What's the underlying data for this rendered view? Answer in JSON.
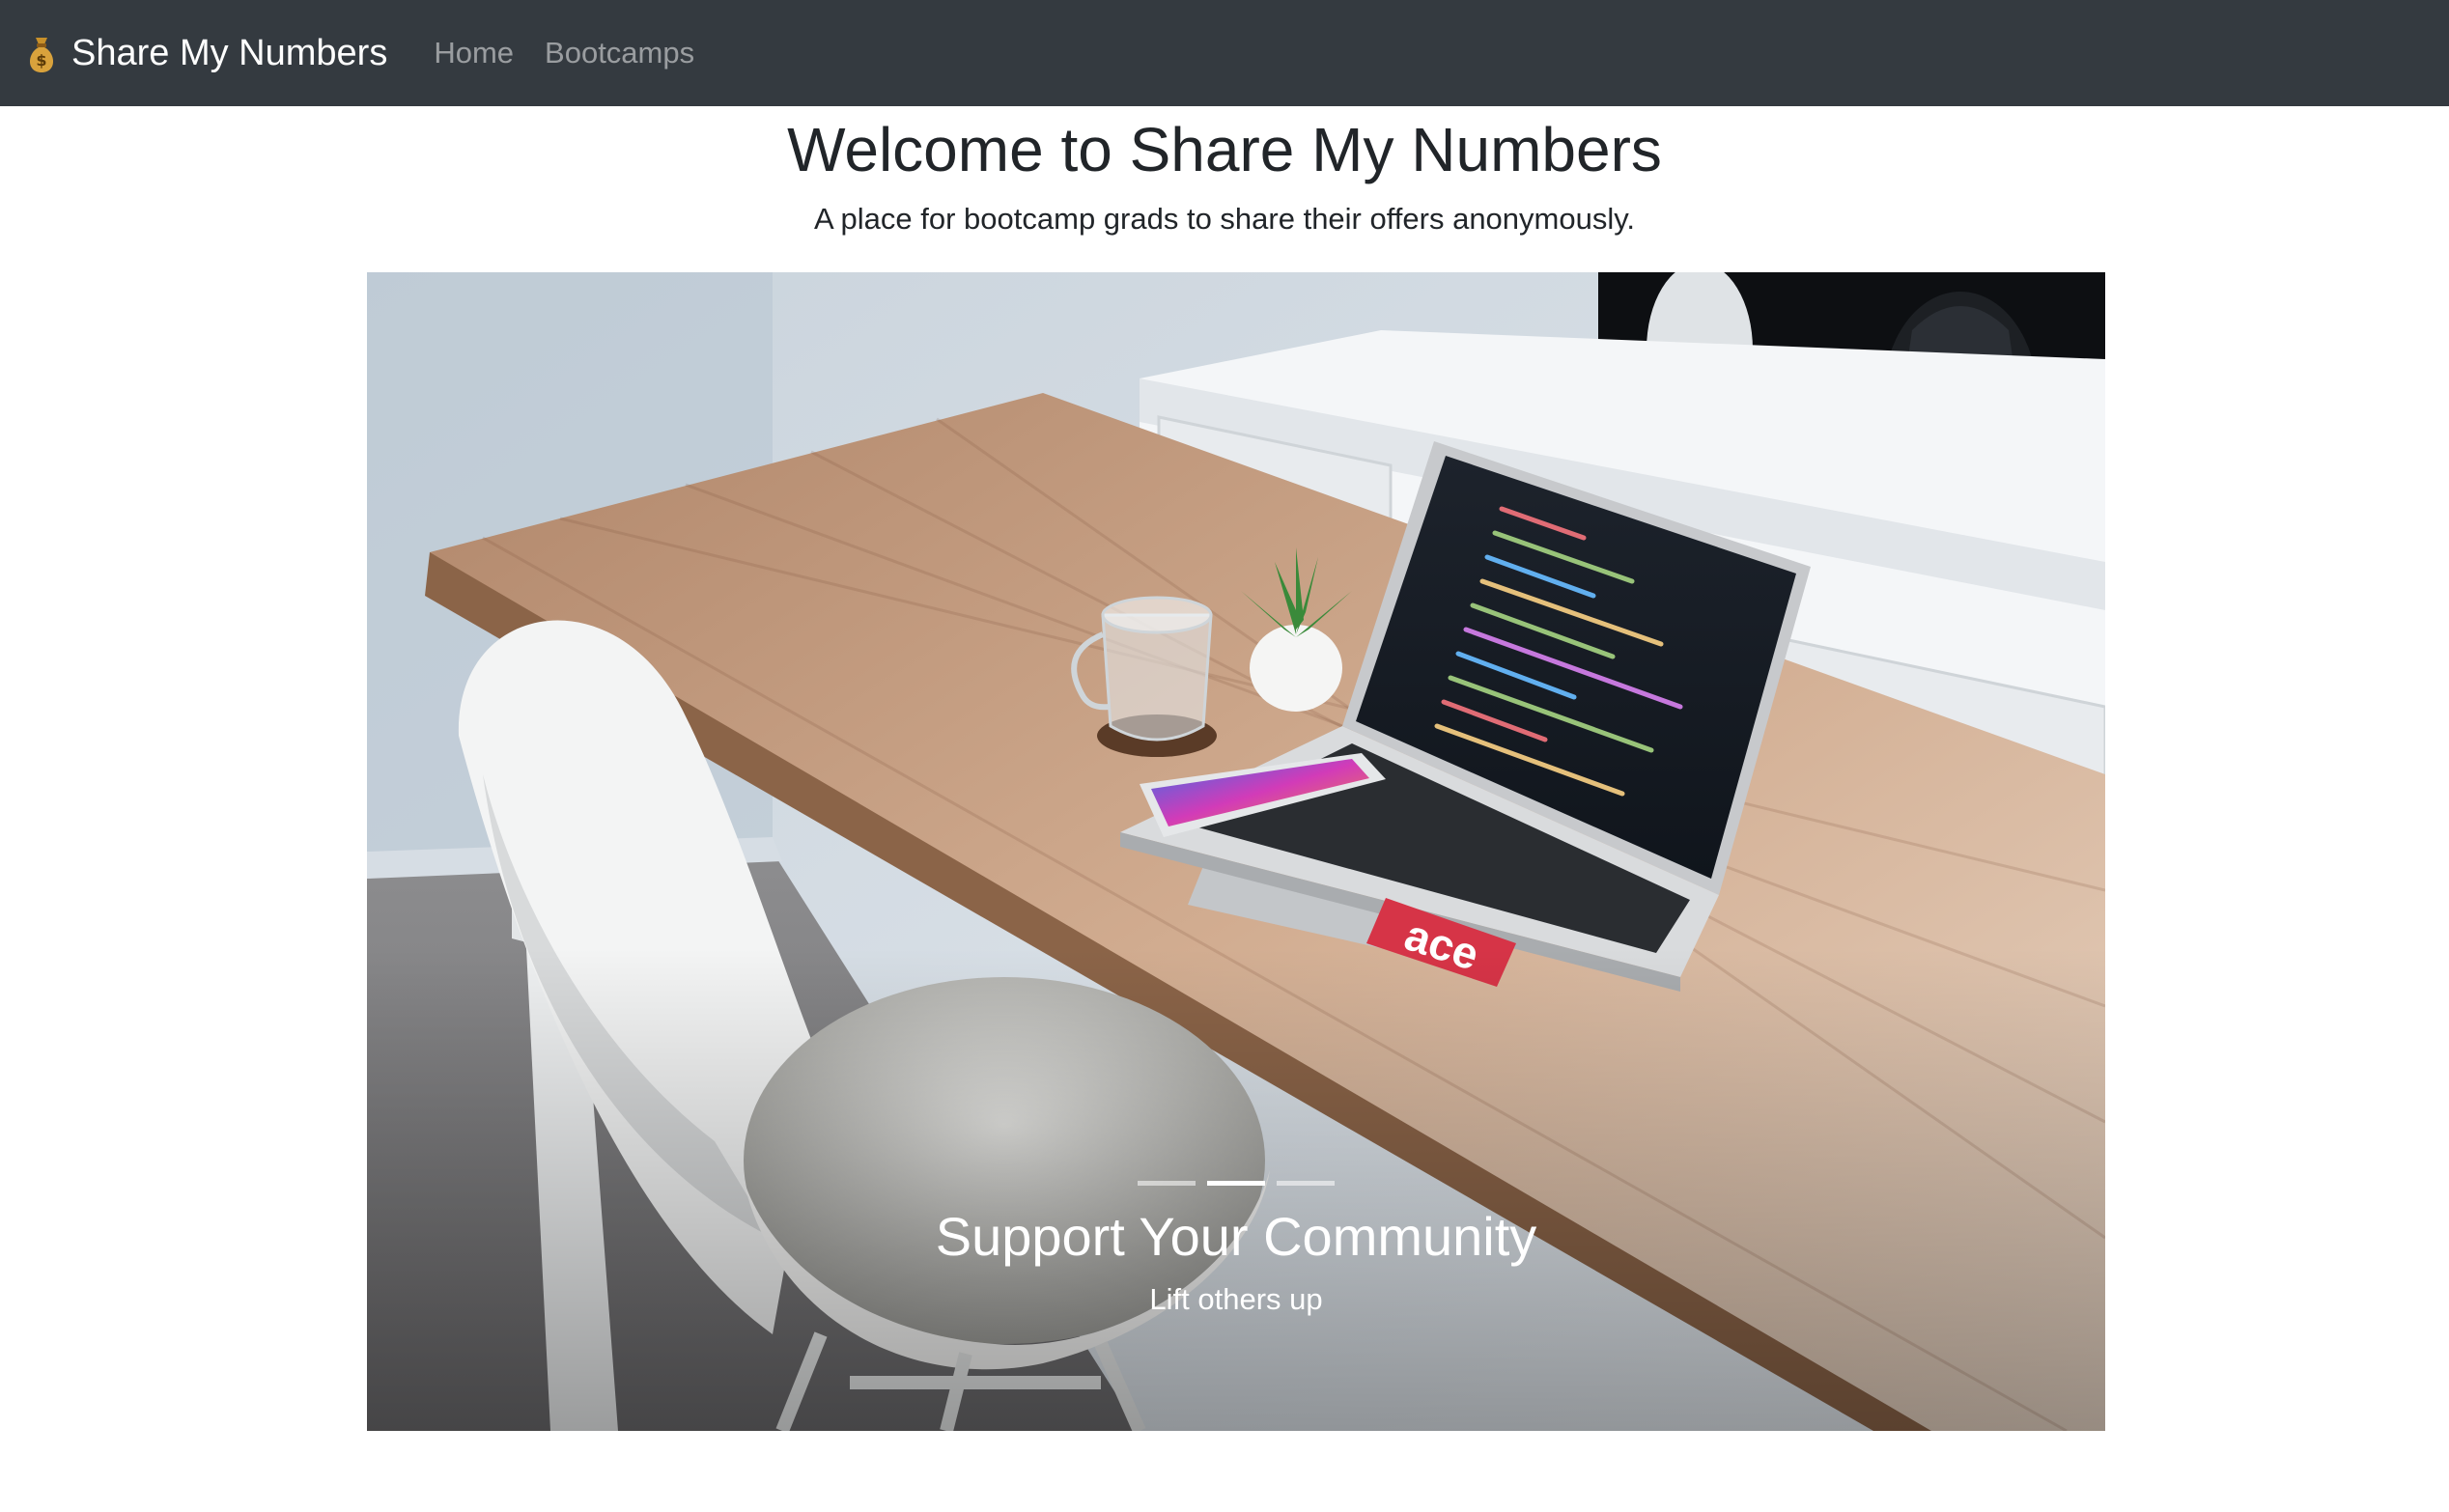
{
  "navbar": {
    "brand_icon": "money-bag-icon",
    "brand_label": "Share My Numbers",
    "links": [
      {
        "label": "Home"
      },
      {
        "label": "Bootcamps"
      }
    ],
    "background": "#343a40"
  },
  "header": {
    "title": "Welcome to Share My Numbers",
    "subtitle": "A place for bootcamp grads to share their offers anonymously."
  },
  "carousel": {
    "slide_count": 3,
    "active_index": 1,
    "caption_title": "Support Your Community",
    "caption_subtitle": "Lift others up",
    "laptop_sticker_text": "ace"
  }
}
